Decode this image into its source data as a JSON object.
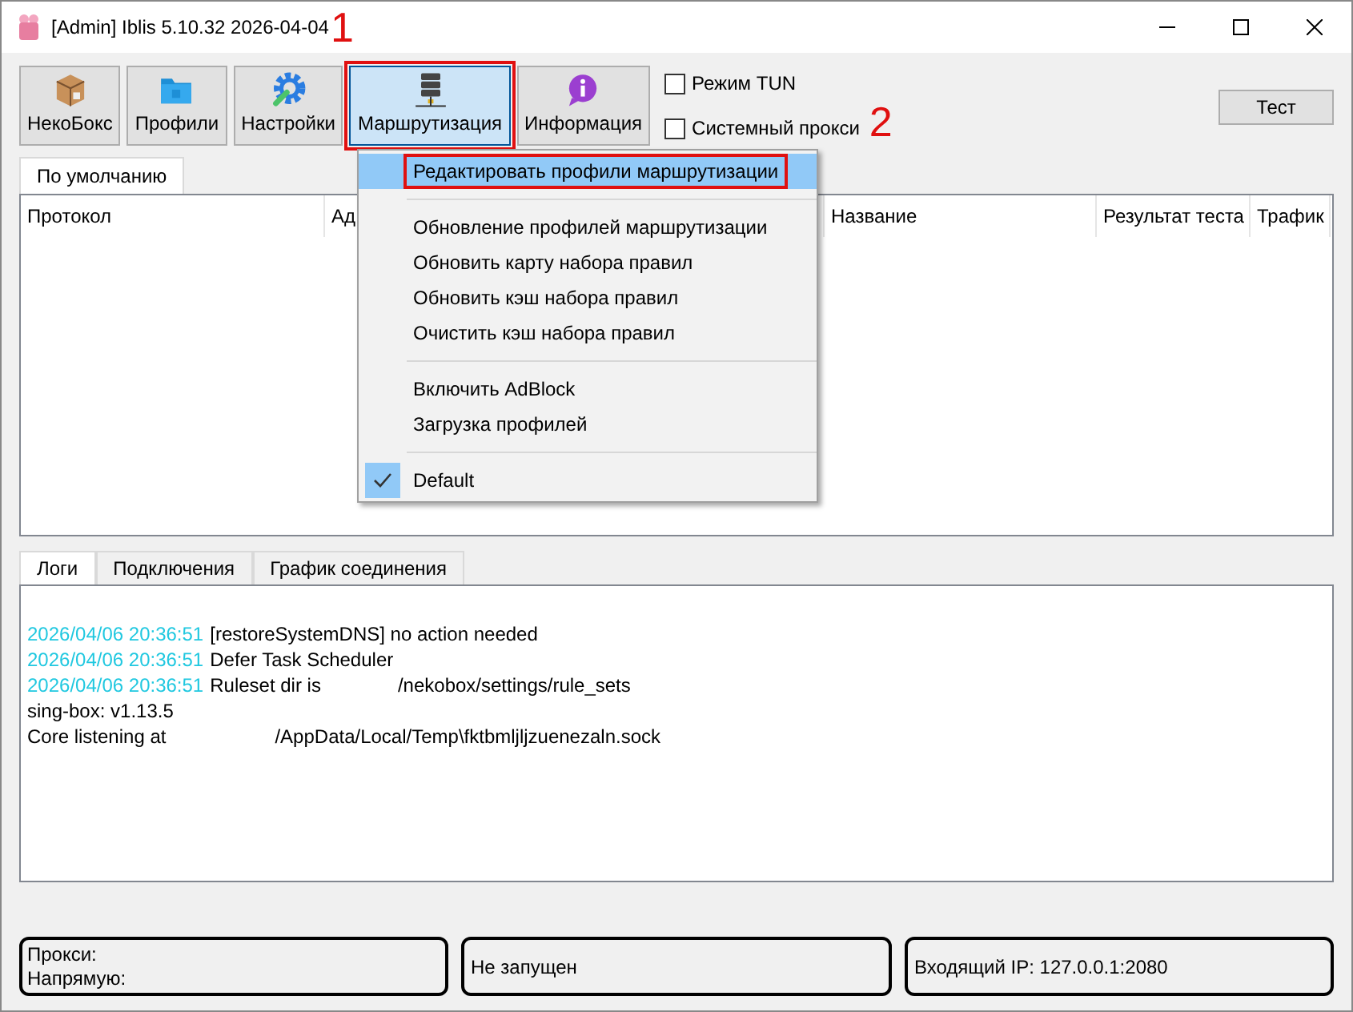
{
  "window": {
    "title": "[Admin] Iblis 5.10.32 2026-04-04",
    "annotation": "1"
  },
  "toolbar": {
    "buttons": [
      {
        "kind": "box",
        "label": "НекоБокс",
        "selected": false
      },
      {
        "kind": "folder",
        "label": "Профили",
        "selected": false
      },
      {
        "kind": "gear",
        "label": "Настройки",
        "selected": false
      },
      {
        "kind": "server",
        "label": "Маршрутизация",
        "selected": true
      },
      {
        "kind": "info",
        "label": "Информация",
        "selected": false
      }
    ],
    "toggles": [
      {
        "label": "Режим TUN",
        "checked": false
      },
      {
        "label": "Системный прокси",
        "checked": false
      }
    ],
    "annotation": "2",
    "test_button": "Тест"
  },
  "profile_tabs": [
    {
      "label": "По умолчанию",
      "selected": true
    }
  ],
  "table": {
    "columns": [
      "Протокол",
      "Ад",
      "Название",
      "Результат теста",
      "Трафик"
    ]
  },
  "menu": {
    "items": [
      {
        "kind": "item",
        "label": "Редактировать профили маршрутизации",
        "selected": true,
        "checked": false
      },
      {
        "kind": "separator"
      },
      {
        "kind": "item",
        "label": "Обновление профилей маршрутизации",
        "selected": false,
        "checked": false
      },
      {
        "kind": "item",
        "label": "Обновить карту набора правил",
        "selected": false,
        "checked": false
      },
      {
        "kind": "item",
        "label": "Обновить кэш набора правил",
        "selected": false,
        "checked": false
      },
      {
        "kind": "item",
        "label": "Очистить кэш набора правил",
        "selected": false,
        "checked": false
      },
      {
        "kind": "separator"
      },
      {
        "kind": "item",
        "label": "Включить AdBlock",
        "selected": false,
        "checked": false
      },
      {
        "kind": "item",
        "label": "Загрузка профилей",
        "selected": false,
        "checked": false
      },
      {
        "kind": "separator"
      },
      {
        "kind": "item",
        "label": "Default",
        "selected": false,
        "checked": true
      }
    ]
  },
  "log_tabs": [
    {
      "label": "Логи",
      "selected": true
    },
    {
      "label": "Подключения",
      "selected": false
    },
    {
      "label": "График соединения",
      "selected": false
    }
  ],
  "log": {
    "lines": [
      {
        "time": "2026/04/06 20:36:51",
        "text": "[restoreSystemDNS] no action needed"
      },
      {
        "time": "2026/04/06 20:36:51",
        "text": "Defer Task Scheduler"
      },
      {
        "time": "2026/04/06 20:36:51",
        "text": "Ruleset dir is",
        "path": "/nekobox/settings/rule_sets"
      },
      {
        "text": "sing-box: v1.13.5"
      },
      {
        "text": "Core listening at",
        "path": "/AppData/Local/Temp\\fktbmljljzuenezaln.sock"
      }
    ]
  },
  "status_bar": {
    "traffic": [
      "Прокси:",
      "Напрямую:"
    ],
    "state": "Не запущен",
    "inbound": "Входящий IP: 127.0.0.1:2080"
  }
}
